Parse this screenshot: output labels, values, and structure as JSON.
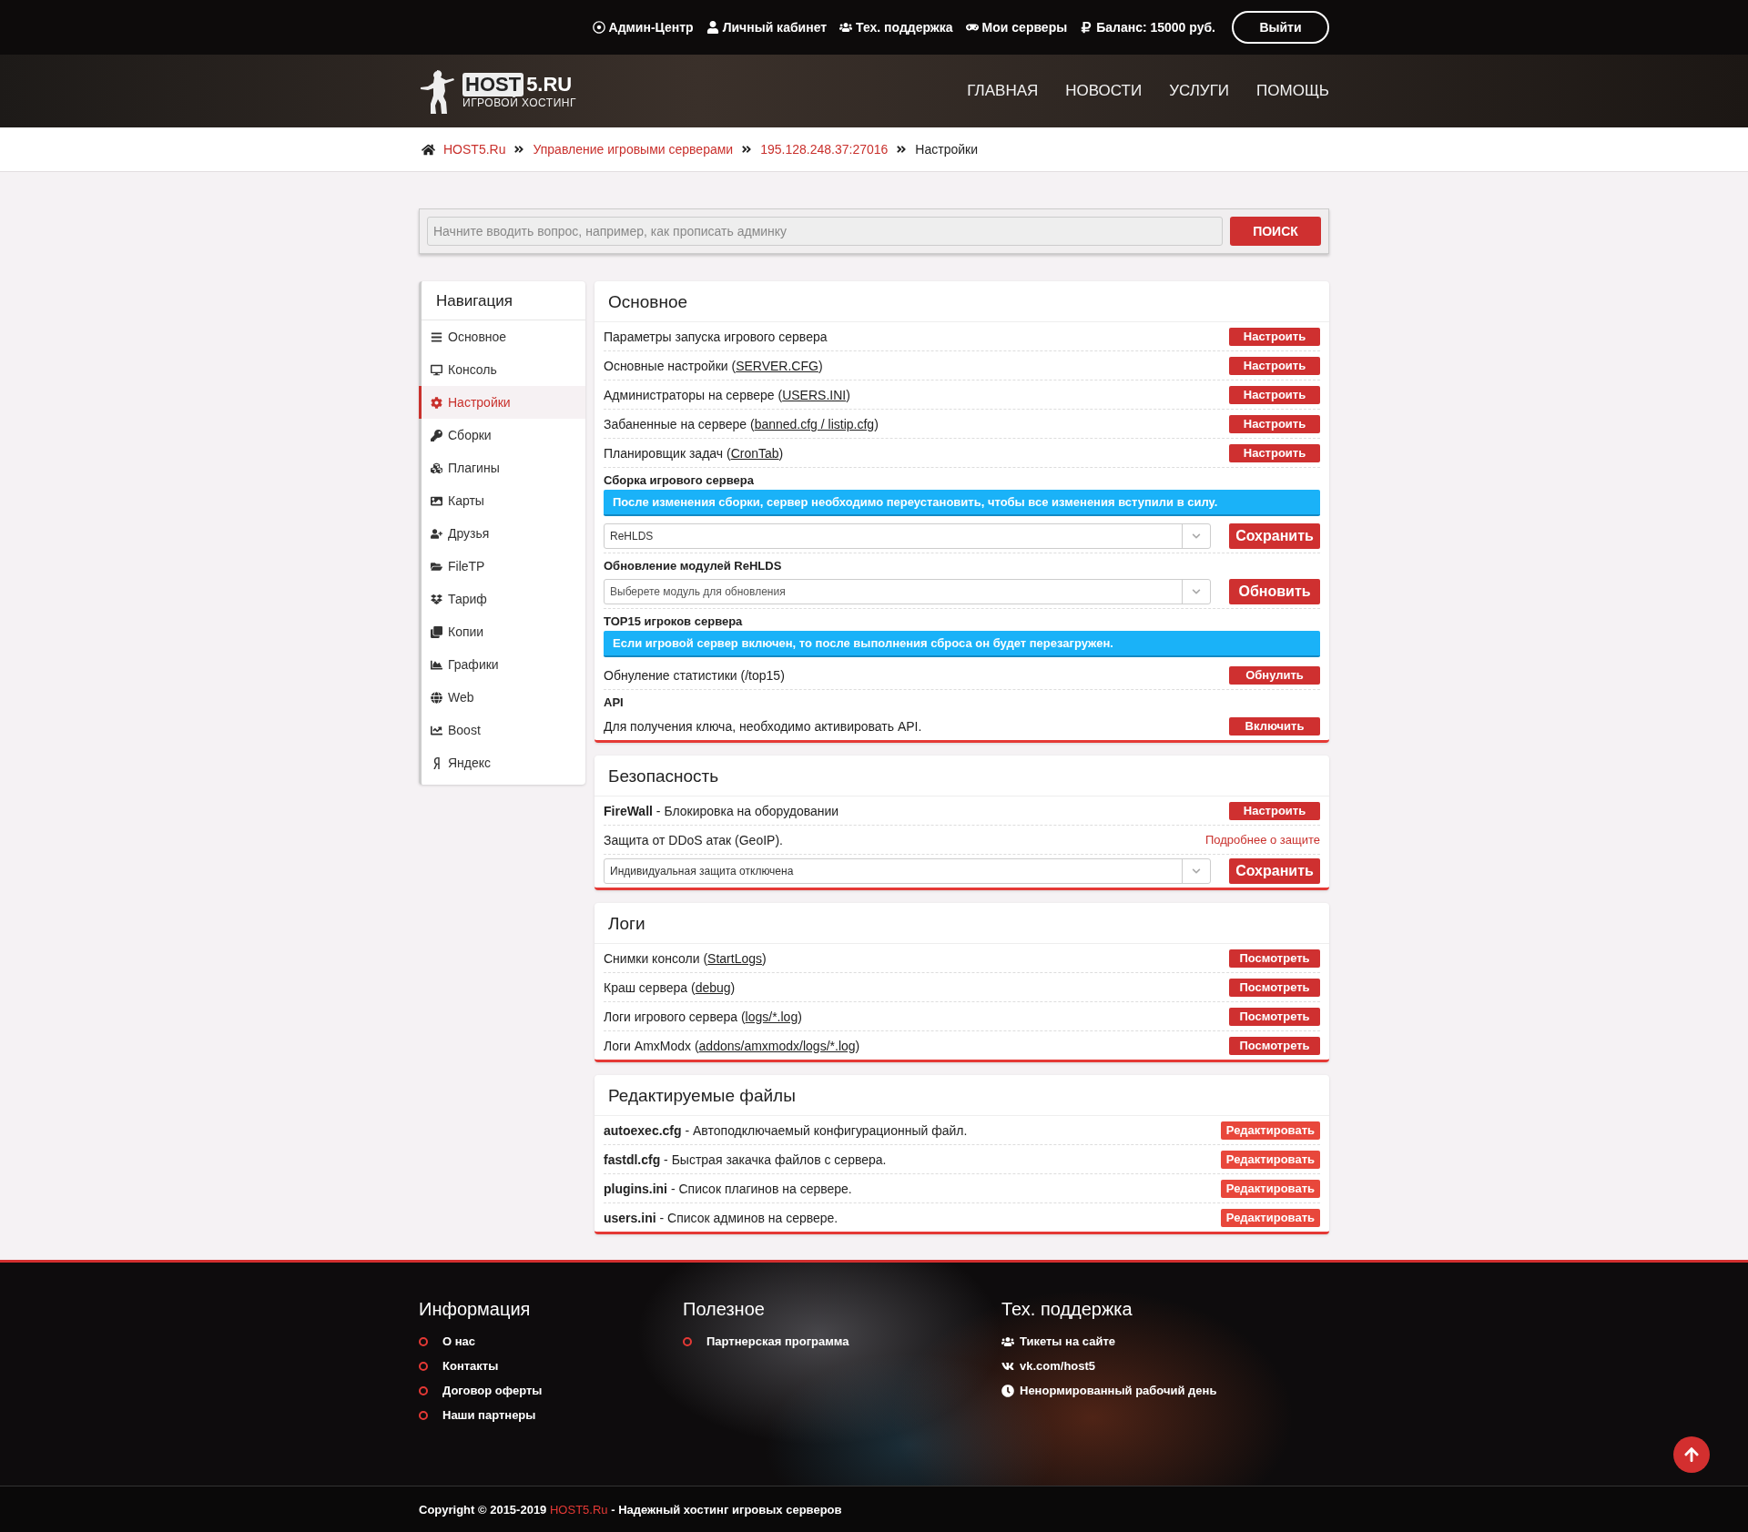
{
  "top_links": [
    "Админ-Центр",
    "Личный кабинет",
    "Тех. поддержка",
    "Мои серверы",
    "Баланс: 15000 руб."
  ],
  "logout": "Выйти",
  "logo": {
    "boxed": "HOST",
    "text": "5.RU",
    "tagline": "ИГРОВОЙ ХОСТИНГ"
  },
  "nav": [
    "ГЛАВНАЯ",
    "НОВОСТИ",
    "УСЛУГИ",
    "ПОМОЩЬ"
  ],
  "breadcrumbs": [
    {
      "label": "HOST5.Ru",
      "link": true
    },
    {
      "label": "Управление игровыми серверами",
      "link": true
    },
    {
      "label": "195.128.248.37:27016",
      "link": true
    },
    {
      "label": "Настройки",
      "link": false
    }
  ],
  "search": {
    "placeholder": "Начните вводить вопрос, например, как прописать админку",
    "button": "ПОИСК"
  },
  "sidebar": {
    "title": "Навигация",
    "items": [
      {
        "label": "Основное",
        "selected": false
      },
      {
        "label": "Консоль",
        "selected": false
      },
      {
        "label": "Настройки",
        "selected": true
      },
      {
        "label": "Сборки",
        "selected": false
      },
      {
        "label": "Плагины",
        "selected": false
      },
      {
        "label": "Карты",
        "selected": false
      },
      {
        "label": "Друзья",
        "selected": false
      },
      {
        "label": "FileTP",
        "selected": false
      },
      {
        "label": "Тариф",
        "selected": false
      },
      {
        "label": "Копии",
        "selected": false
      },
      {
        "label": "Графики",
        "selected": false
      },
      {
        "label": "Web",
        "selected": false
      },
      {
        "label": "Boost",
        "selected": false
      },
      {
        "label": "Яндекс",
        "selected": false
      }
    ]
  },
  "sections": [
    {
      "title": "Основное",
      "kind": "settings",
      "items": [
        {
          "kind": "row",
          "text": "Параметры запуска игрового сервера",
          "button": "Настроить"
        },
        {
          "kind": "row",
          "text": "Основные настройки (",
          "link": "SERVER.CFG",
          "suffix": ")",
          "button": "Настроить"
        },
        {
          "kind": "row",
          "text": "Администраторы на сервере (",
          "link": "USERS.INI",
          "suffix": ")",
          "button": "Настроить"
        },
        {
          "kind": "row",
          "text": "Забаненные на сервере (",
          "link": "banned.cfg / listip.cfg",
          "suffix": ")",
          "button": "Настроить"
        },
        {
          "kind": "row",
          "text": "Планировщик задач (",
          "link": "CronTab",
          "suffix": ")",
          "button": "Настроить"
        },
        {
          "kind": "heading",
          "text": "Сборка игрового сервера"
        },
        {
          "kind": "alert",
          "text": "После изменения сборки, сервер необходимо переустановить, чтобы все изменения вступили в силу."
        },
        {
          "kind": "select",
          "value": "ReHLDS",
          "button": "Сохранить"
        },
        {
          "kind": "heading",
          "text": "Обновление модулей ReHLDS"
        },
        {
          "kind": "select",
          "placeholder": "Выберете модуль для обновления",
          "button": "Обновить"
        },
        {
          "kind": "heading",
          "text": "TOP15 игроков сервера"
        },
        {
          "kind": "alert",
          "text": "Если игровой сервер включен, то после выполнения сброса он будет перезагружен."
        },
        {
          "kind": "row",
          "text": "Обнуление статистики (/top15)",
          "button": "Обнулить"
        },
        {
          "kind": "heading",
          "text": "API"
        },
        {
          "kind": "row",
          "text": "Для получения ключа, необходимо активировать API.",
          "button": "Включить"
        }
      ]
    },
    {
      "title": "Безопасность",
      "kind": "settings",
      "items": [
        {
          "kind": "row",
          "text": "**FireWall** - Блокировка на оборудовании",
          "button": "Настроить"
        },
        {
          "kind": "note",
          "text": "Защита от DDoS атак (GeoIP).",
          "action": "Подробнее о защите"
        },
        {
          "kind": "select",
          "value": "Индивидуальная защита отключена",
          "button": "Сохранить"
        }
      ]
    },
    {
      "title": "Логи",
      "kind": "settings",
      "items": [
        {
          "kind": "row",
          "text": "Снимки консоли (",
          "link": "StartLogs",
          "suffix": ")",
          "button": "Посмотреть"
        },
        {
          "kind": "row",
          "text": "Краш сервера (",
          "link": "debug",
          "suffix": ")",
          "button": "Посмотреть"
        },
        {
          "kind": "row",
          "text": "Логи игрового сервера (",
          "link": "logs/*.log",
          "suffix": ")",
          "button": "Посмотреть"
        },
        {
          "kind": "row",
          "text": "Логи AmxModx (",
          "link": "addons/amxmodx/logs/*.log",
          "suffix": ")",
          "button": "Посмотреть"
        }
      ]
    },
    {
      "title": "Редактируемые файлы",
      "kind": "files",
      "items": [
        {
          "kind": "row",
          "text": "**autoexec.cfg** - Автоподключаемый конфигурационный файл.",
          "button": "Редактировать"
        },
        {
          "kind": "row",
          "text": "**fastdl.cfg** - Быстрая закачка файлов с сервера.",
          "button": "Редактировать"
        },
        {
          "kind": "row",
          "text": "**plugins.ini** - Список плагинов на сервере.",
          "button": "Редактировать"
        },
        {
          "kind": "row",
          "text": "**users.ini** - Список админов на сервере.",
          "button": "Редактировать"
        }
      ]
    }
  ],
  "footer": {
    "columns": [
      {
        "title": "Информация",
        "kind": "bullets",
        "items": [
          "О нас",
          "Контакты",
          "Договор оферты",
          "Наши партнеры"
        ]
      },
      {
        "title": "Полезное",
        "kind": "bullets",
        "items": [
          "Партнерская программа"
        ]
      },
      {
        "title": "Тех. поддержка",
        "kind": "icons",
        "items": [
          "Тикеты на сайте",
          "vk.com/host5",
          "Ненормированный рабочий день"
        ]
      }
    ],
    "copyright": "Copyright © 2015-2019",
    "brand": "HOST5.Ru",
    "slogan": "- Надежный хостинг игровых серверов"
  }
}
